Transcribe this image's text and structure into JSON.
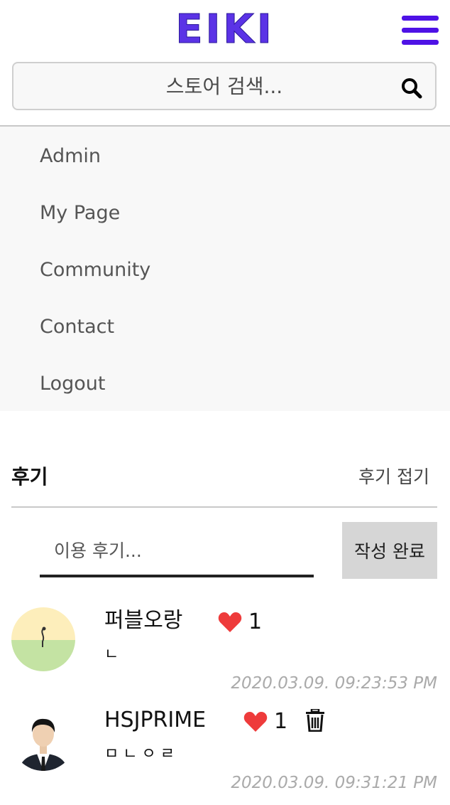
{
  "header": {
    "logo": "EIKI",
    "menu_icon": "hamburger-menu-icon",
    "accent_color": "#5b33e6"
  },
  "search": {
    "placeholder": "스토어 검색...",
    "icon": "search-icon"
  },
  "menu": {
    "items": [
      {
        "label": "Admin"
      },
      {
        "label": "My Page"
      },
      {
        "label": "Community"
      },
      {
        "label": "Contact"
      },
      {
        "label": "Logout"
      }
    ]
  },
  "reviews": {
    "title": "후기",
    "fold_label": "후기 접기",
    "input_placeholder": "이용 후기...",
    "submit_label": "작성 완료",
    "items": [
      {
        "user": "퍼블오랑",
        "likes": "1",
        "text": "ㄴ",
        "date": "2020.03.09. 09:23:53 PM",
        "heart_color": "#ee3b3b"
      },
      {
        "user": "HSJPRIME",
        "likes": "1",
        "text": "ㅁㄴㅇㄹ",
        "date": "2020.03.09. 09:31:21 PM",
        "heart_color": "#ee3b3b",
        "delete_icon": "trash-icon"
      }
    ]
  }
}
